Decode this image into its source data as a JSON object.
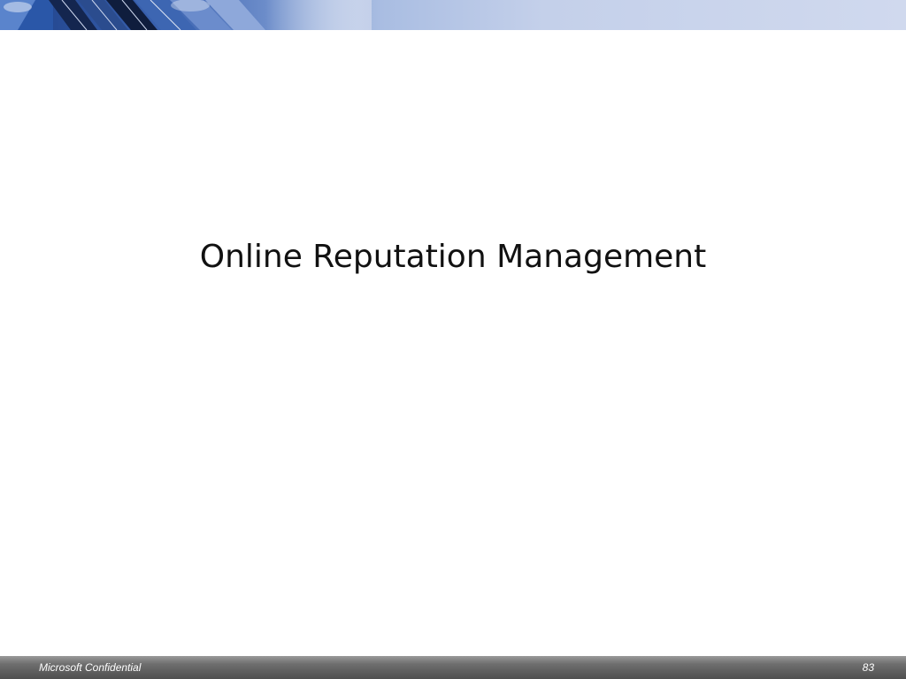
{
  "slide": {
    "title": "Online Reputation Management",
    "footer": {
      "confidentiality": "Microsoft Confidential",
      "page_number": "83"
    }
  },
  "theme": {
    "banner_dark": "#1d3f86",
    "banner_light": "#d0d9ee",
    "footer_bar": "#5e5e5e",
    "title_color": "#111111"
  }
}
